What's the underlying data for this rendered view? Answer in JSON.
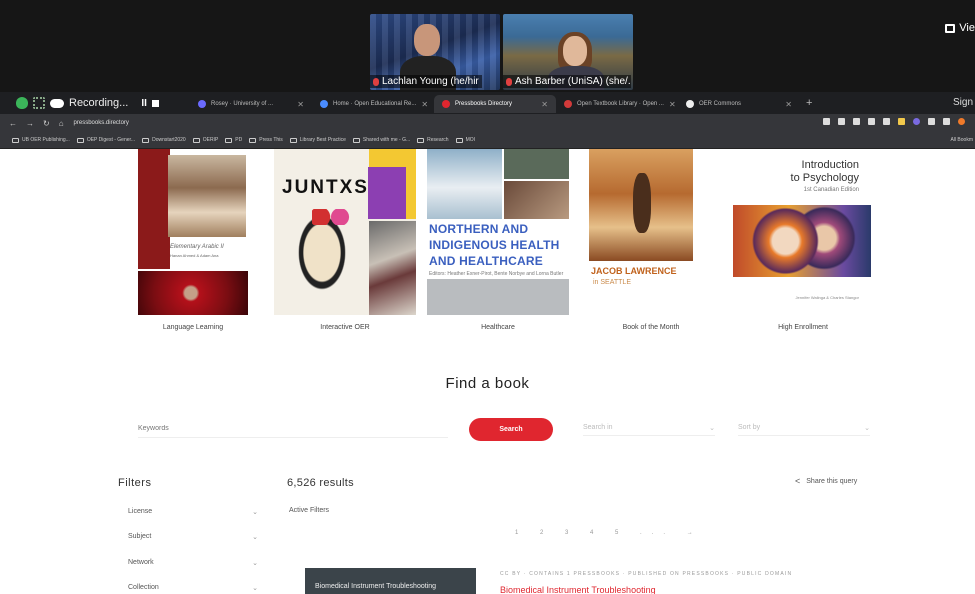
{
  "video_call": {
    "participants": [
      {
        "name": "Lachlan Young (he/hir"
      },
      {
        "name": "Ash Barber (UniSA) (she/..."
      }
    ],
    "view_label": "Vie"
  },
  "browser": {
    "recording_label": "Recording...",
    "tabs": [
      {
        "label": "Rosey · University of ...",
        "active": false,
        "fav_color": "#6a6aff"
      },
      {
        "label": "Home · Open Educational Re...",
        "active": false,
        "fav_color": "#4a8cff"
      },
      {
        "label": "Pressbooks Directory",
        "active": true,
        "fav_color": "#e0262f"
      },
      {
        "label": "Open Textbook Library · Open ...",
        "active": false,
        "fav_color": "#d23a3a"
      },
      {
        "label": "OER Commons",
        "active": false,
        "fav_color": "#eeeeee"
      }
    ],
    "sign_label": "Sign",
    "address": "pressbooks.directory",
    "bookmarks": [
      "UB OER Publishing...",
      "OEP Digest - Gener...",
      "Downstart2020",
      "OERIP",
      "PD",
      "Press This",
      "Library Best Practice",
      "Shared with me - G...",
      "Research",
      "MOI"
    ],
    "bookmarks_right": "All Bookm"
  },
  "carousel": [
    {
      "caption": "Language Learning",
      "title": "Elementary Arabic II",
      "authors": "Hanan Ahmed & Adam Ana"
    },
    {
      "caption": "Interactive OER",
      "title": "JUNTXS"
    },
    {
      "caption": "Healthcare",
      "title": "NORTHERN AND\nINDIGENOUS HEALTH\nAND HEALTHCARE",
      "subtitle": "Editors: Heather Exner-Pirot, Bente Norbye and Lorna Butler"
    },
    {
      "caption": "Book of the Month",
      "title": "JACOB LAWRENCE",
      "subtitle": "in SEATTLE"
    },
    {
      "caption": "High Enrollment",
      "title": "Introduction\nto Psychology",
      "subtitle": "1st Canadian Edition",
      "authors": "Jennifer Walinga & Charles Stangor"
    }
  ],
  "search": {
    "heading": "Find a book",
    "keyword_placeholder": "Keywords",
    "button_label": "Search",
    "select_1": "Search in",
    "select_2": "Sort by"
  },
  "filters": {
    "title": "Filters",
    "items": [
      "License",
      "Subject",
      "Network",
      "Collection"
    ]
  },
  "results": {
    "count": "6,526 results",
    "share_label": "Share this query",
    "active_filters_label": "Active Filters",
    "pagination": "1 2 3 4 5 ... →",
    "first": {
      "thumb_title": "Biomedical Instrument Troubleshooting",
      "meta": "CC BY · CONTAINS 1 PRESSBOOKS · PUBLISHED ON PRESSBOOKS · PUBLIC DOMAIN",
      "title": "Biomedical Instrument Troubleshooting"
    }
  }
}
